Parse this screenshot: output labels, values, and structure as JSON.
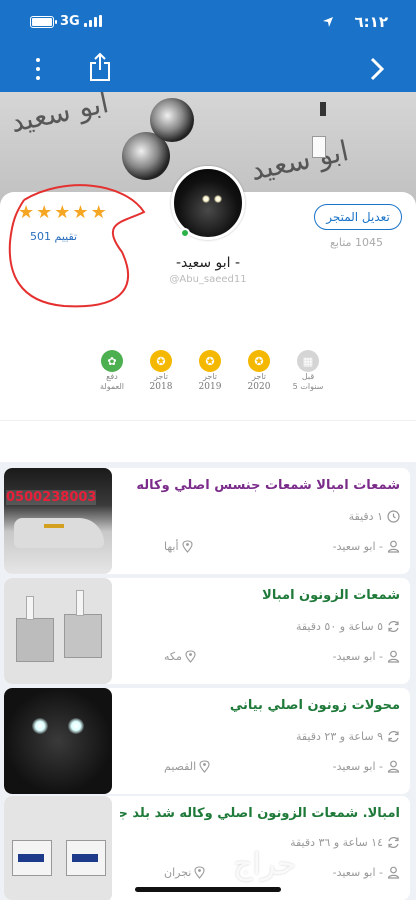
{
  "status_bar": {
    "time": "٦:١٢",
    "network": "3G"
  },
  "cover": {
    "watermark": "ابو سعيد"
  },
  "profile": {
    "rating_count": "501 تقييم",
    "edit_button": "تعديل المتجر",
    "followers": "1045 متابع",
    "name": "-ابو سعيد -",
    "handle": "@Abu_saeed11"
  },
  "badges": [
    {
      "line1": "دفع",
      "line2": "العمولة",
      "color": "#4caf50",
      "icon": "gear-check-icon"
    },
    {
      "line1": "تاجر",
      "line2": "2018",
      "color": "#f5b800",
      "icon": "medal-icon"
    },
    {
      "line1": "تاجر",
      "line2": "2019",
      "color": "#f5b800",
      "icon": "medal-icon"
    },
    {
      "line1": "تاجر",
      "line2": "2020",
      "color": "#f5b800",
      "icon": "medal-icon"
    },
    {
      "line1": "قبل",
      "line2": "5 سنوات",
      "color": "#d5d5d5",
      "icon": "calendar-icon"
    }
  ],
  "listings": [
    {
      "title": "شمعات امبالا شمعات جنسس اصلي وكاله",
      "title_color": "#7b2c8a",
      "time": "١ دقيقة",
      "seller": "- ابو سعيد-",
      "city": "أبها",
      "phone": "0500238003"
    },
    {
      "title": "شمعات الزونون امبالا",
      "title_color": "#1f7a3a",
      "time": "٥ ساعة و ٥٠ دقيقة",
      "seller": "- ابو سعيد-",
      "city": "مكه"
    },
    {
      "title": "محولات زونون اصلي بياني",
      "title_color": "#1f7a3a",
      "time": "٩ ساعة و ٢٣ دقيقة",
      "seller": "- ابو سعيد-",
      "city": "القصيم"
    },
    {
      "title": "امبالا. شمعات الزونون اصلي وكاله شد بلد جديد",
      "title_color": "#1f7a3a",
      "time": "١٤ ساعة و ٣٦ دقيقة",
      "seller": "- ابو سعيد-",
      "city": "نجران"
    }
  ],
  "brand_watermark": "حراج"
}
